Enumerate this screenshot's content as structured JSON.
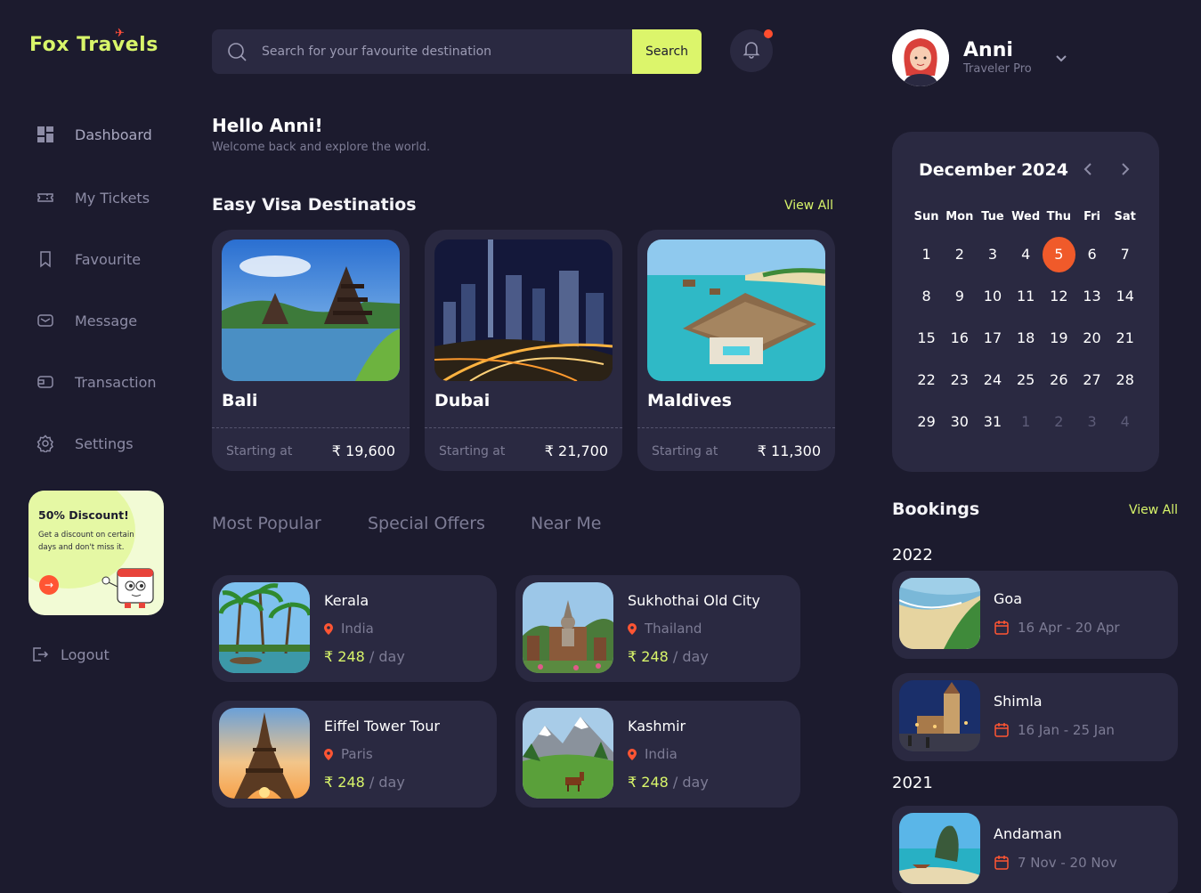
{
  "brand": {
    "name": "Fox Travels",
    "accent": "#d8f56a",
    "danger": "#ff4d2e"
  },
  "sidebar": {
    "items": [
      {
        "label": "Dashboard",
        "icon": "dashboard-icon"
      },
      {
        "label": "My Tickets",
        "icon": "ticket-icon"
      },
      {
        "label": "Favourite",
        "icon": "bookmark-icon"
      },
      {
        "label": "Message",
        "icon": "mail-icon"
      },
      {
        "label": "Transaction",
        "icon": "wallet-icon"
      },
      {
        "label": "Settings",
        "icon": "gear-icon"
      }
    ],
    "promo": {
      "title": "50% Discount!",
      "text": "Get a discount on certain days and don't miss it."
    },
    "logout": "Logout"
  },
  "search": {
    "placeholder": "Search for your favourite destination",
    "button": "Search"
  },
  "greeting": {
    "title": "Hello Anni!",
    "subtitle": "Welcome back and explore the world."
  },
  "visa": {
    "title": "Easy Visa Destinatios",
    "view_all": "View All",
    "cards": [
      {
        "name": "Bali",
        "starting": "Starting at",
        "price": "₹ 19,600"
      },
      {
        "name": "Dubai",
        "starting": "Starting at",
        "price": "₹ 21,700"
      },
      {
        "name": "Maldives",
        "starting": "Starting at",
        "price": "₹ 11,300"
      }
    ]
  },
  "tabs": [
    "Most Popular",
    "Special Offers",
    "Near Me"
  ],
  "popular": [
    {
      "name": "Kerala",
      "location": "India",
      "price": "₹ 248",
      "unit": "/ day"
    },
    {
      "name": "Sukhothai Old City",
      "location": "Thailand",
      "price": "₹ 248",
      "unit": "/ day"
    },
    {
      "name": "Eiffel Tower Tour",
      "location": "Paris",
      "price": "₹ 248",
      "unit": "/ day"
    },
    {
      "name": "Kashmir",
      "location": "India",
      "price": "₹ 248",
      "unit": "/ day"
    }
  ],
  "profile": {
    "name": "Anni",
    "role": "Traveler Pro"
  },
  "calendar": {
    "month": "December 2024",
    "weekdays": [
      "Sun",
      "Mon",
      "Tue",
      "Wed",
      "Thu",
      "Fri",
      "Sat"
    ],
    "days": [
      "1",
      "2",
      "3",
      "4",
      "5",
      "6",
      "7",
      "8",
      "9",
      "10",
      "11",
      "12",
      "13",
      "14",
      "15",
      "16",
      "17",
      "18",
      "19",
      "20",
      "21",
      "22",
      "23",
      "24",
      "25",
      "26",
      "27",
      "28",
      "29",
      "30",
      "31",
      "1",
      "2",
      "3",
      "4"
    ],
    "today": "5",
    "today_color": "#f05a2a"
  },
  "bookings": {
    "title": "Bookings",
    "view_all": "View All",
    "groups": [
      {
        "year": "2022",
        "items": [
          {
            "name": "Goa",
            "dates": "16 Apr - 20 Apr"
          },
          {
            "name": "Shimla",
            "dates": "16 Jan - 25 Jan"
          }
        ]
      },
      {
        "year": "2021",
        "items": [
          {
            "name": "Andaman",
            "dates": "7 Nov - 20 Nov"
          }
        ]
      }
    ]
  }
}
